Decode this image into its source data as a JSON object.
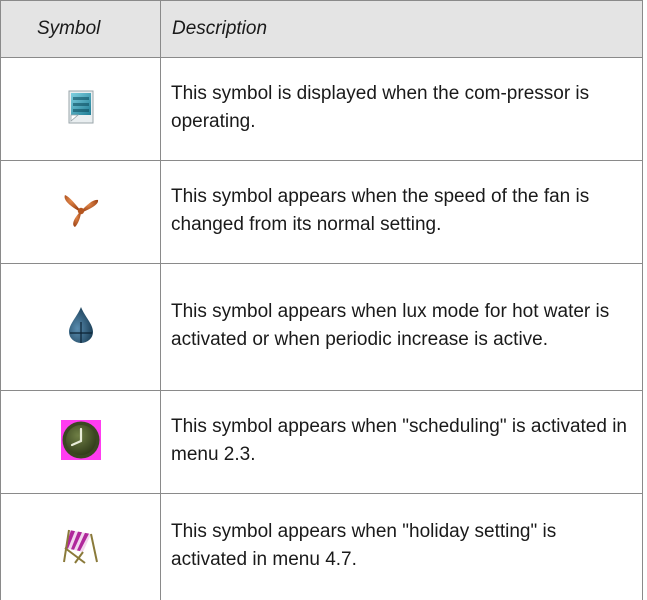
{
  "table": {
    "header": {
      "symbol": "Symbol",
      "description": "Description"
    },
    "rows": [
      {
        "icon": "compressor-icon",
        "description": "This symbol is displayed when the com-pressor is operating."
      },
      {
        "icon": "fan-icon",
        "description": "This symbol appears when the speed of the fan is changed from its normal setting."
      },
      {
        "icon": "water-drop-icon",
        "description": "This symbol appears when lux mode for hot water is activated or when periodic increase is active."
      },
      {
        "icon": "clock-icon",
        "description": "This symbol appears when \"scheduling\" is activated in menu 2.3."
      },
      {
        "icon": "deck-chair-icon",
        "description": "This symbol appears when \"holiday setting\" is activated in menu 4.7."
      }
    ]
  },
  "colors": {
    "header_bg": "#e4e4e4",
    "border": "#8a8a8a",
    "fan": "#b5561f",
    "drop": "#1f4f6b",
    "clock_bg": "#ff3cf0",
    "clock_face": "#4a5a2c",
    "chair_stripe": "#b0279b"
  }
}
